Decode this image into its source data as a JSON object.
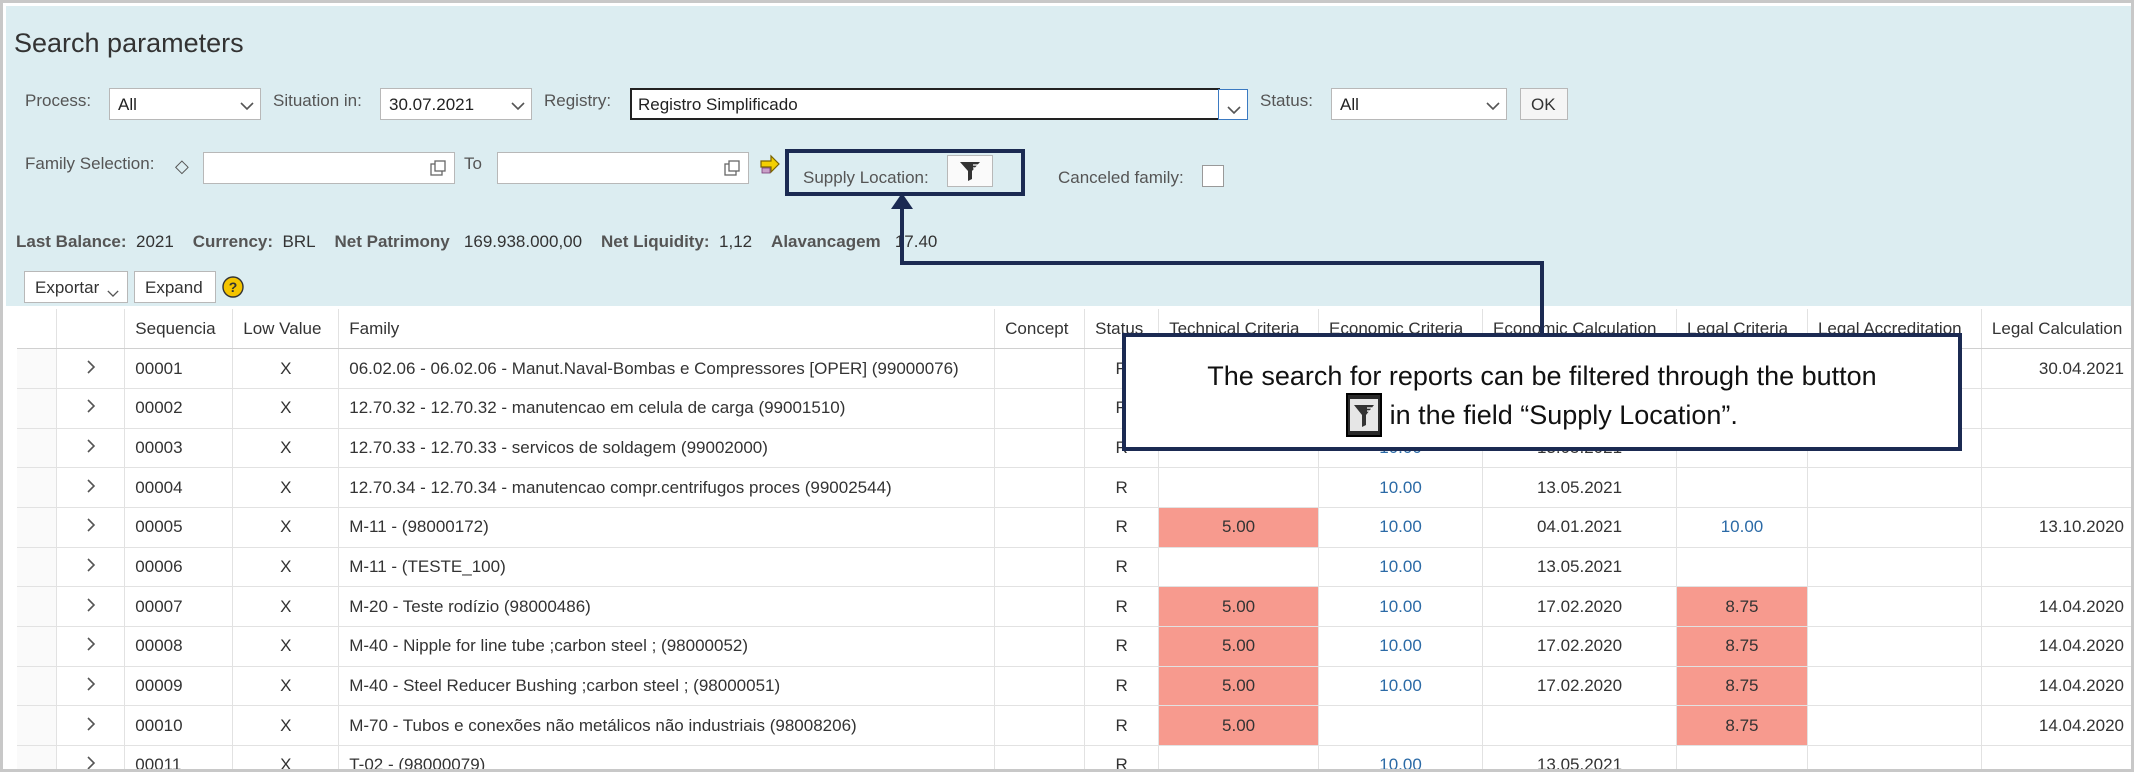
{
  "header": {
    "title": "Search parameters"
  },
  "filters": {
    "process_label": "Process:",
    "process_value": "All",
    "situation_label": "Situation in:",
    "situation_value": "30.07.2021",
    "registry_label": "Registry:",
    "registry_value": "Registro Simplificado",
    "status_label": "Status:",
    "status_value": "All",
    "ok_label": "OK",
    "family_label": "Family Selection:",
    "to_label": "To",
    "supply_label": "Supply Location:",
    "canceled_label": "Canceled family:"
  },
  "summary": {
    "last_balance_label": "Last Balance:",
    "last_balance_value": "2021",
    "currency_label": "Currency:",
    "currency_value": "BRL",
    "net_patrimony_label": "Net Patrimony",
    "net_patrimony_value": "169.938.000,00",
    "net_liquidity_label": "Net Liquidity:",
    "net_liquidity_value": "1,12",
    "alavancagem_label": "Alavancagem",
    "alavancagem_value": "17.40"
  },
  "toolbar": {
    "export_label": "Exportar",
    "expand_label": "Expand"
  },
  "table": {
    "columns": [
      "Sequencia",
      "Low Value",
      "Family",
      "Concept",
      "Status",
      "Technical Criteria",
      "Economic Criteria",
      "Economic Calculation",
      "Legal Criteria",
      "Legal Accreditation",
      "Legal Calculation"
    ],
    "rows": [
      {
        "seq": "00001",
        "low": "X",
        "family": "06.02.06 - 06.02.06 - Manut.Naval-Bombas e Compressores [OPER] (99000076)",
        "concept": "",
        "status": "R",
        "tech": "",
        "econ": "",
        "calc": "",
        "legal": "",
        "accr": "",
        "lcalc": "30.04.2021"
      },
      {
        "seq": "00002",
        "low": "X",
        "family": "12.70.32 - 12.70.32 - manutencao em celula de carga  (99001510)",
        "concept": "",
        "status": "R",
        "tech": "",
        "econ": "",
        "calc": "",
        "legal": "",
        "accr": "",
        "lcalc": ""
      },
      {
        "seq": "00003",
        "low": "X",
        "family": "12.70.33 - 12.70.33 - servicos de soldagem  (99002000)",
        "concept": "",
        "status": "R",
        "tech": "",
        "econ": "10.00",
        "calc": "13.05.2021",
        "legal": "",
        "accr": "",
        "lcalc": ""
      },
      {
        "seq": "00004",
        "low": "X",
        "family": "12.70.34 - 12.70.34 - manutencao compr.centrifugos proces  (99002544)",
        "concept": "",
        "status": "R",
        "tech": "",
        "econ": "10.00",
        "calc": "13.05.2021",
        "legal": "",
        "accr": "",
        "lcalc": ""
      },
      {
        "seq": "00005",
        "low": "X",
        "family": "M-11 -  (98000172)",
        "concept": "",
        "status": "R",
        "tech": "5.00",
        "econ": "10.00",
        "calc": "04.01.2021",
        "legal": "10.00",
        "accr": "",
        "lcalc": "13.10.2020"
      },
      {
        "seq": "00006",
        "low": "X",
        "family": "M-11 -  (TESTE_100)",
        "concept": "",
        "status": "R",
        "tech": "",
        "econ": "10.00",
        "calc": "13.05.2021",
        "legal": "",
        "accr": "",
        "lcalc": ""
      },
      {
        "seq": "00007",
        "low": "X",
        "family": "M-20 - Teste rodízio  (98000486)",
        "concept": "",
        "status": "R",
        "tech": "5.00",
        "econ": "10.00",
        "calc": "17.02.2020",
        "legal": "8.75",
        "accr": "",
        "lcalc": "14.04.2020"
      },
      {
        "seq": "00008",
        "low": "X",
        "family": "M-40 - Nipple for line tube ;carbon steel ;  (98000052)",
        "concept": "",
        "status": "R",
        "tech": "5.00",
        "econ": "10.00",
        "calc": "17.02.2020",
        "legal": "8.75",
        "accr": "",
        "lcalc": "14.04.2020"
      },
      {
        "seq": "00009",
        "low": "X",
        "family": "M-40 - Steel Reducer Bushing ;carbon steel ;  (98000051)",
        "concept": "",
        "status": "R",
        "tech": "5.00",
        "econ": "10.00",
        "calc": "17.02.2020",
        "legal": "8.75",
        "accr": "",
        "lcalc": "14.04.2020"
      },
      {
        "seq": "00010",
        "low": "X",
        "family": "M-70 - Tubos e conexões não metálicos não industriais  (98008206)",
        "concept": "",
        "status": "R",
        "tech": "5.00",
        "econ": "",
        "calc": "",
        "legal": "8.75",
        "accr": "",
        "lcalc": "14.04.2020"
      },
      {
        "seq": "00011",
        "low": "X",
        "family": "T-02 -  (98000079)",
        "concept": "",
        "status": "R",
        "tech": "",
        "econ": "10.00",
        "calc": "13.05.2021",
        "legal": "",
        "accr": "",
        "lcalc": ""
      }
    ]
  },
  "callout": {
    "line1": "The search for reports can be filtered through the button",
    "line2": "in the field “Supply Location”."
  },
  "colors": {
    "panel_bg": "#dcedf1",
    "highlight_red": "#f79a8e",
    "callout_border": "#1b2a52",
    "link_blue": "#2b6aa6"
  }
}
